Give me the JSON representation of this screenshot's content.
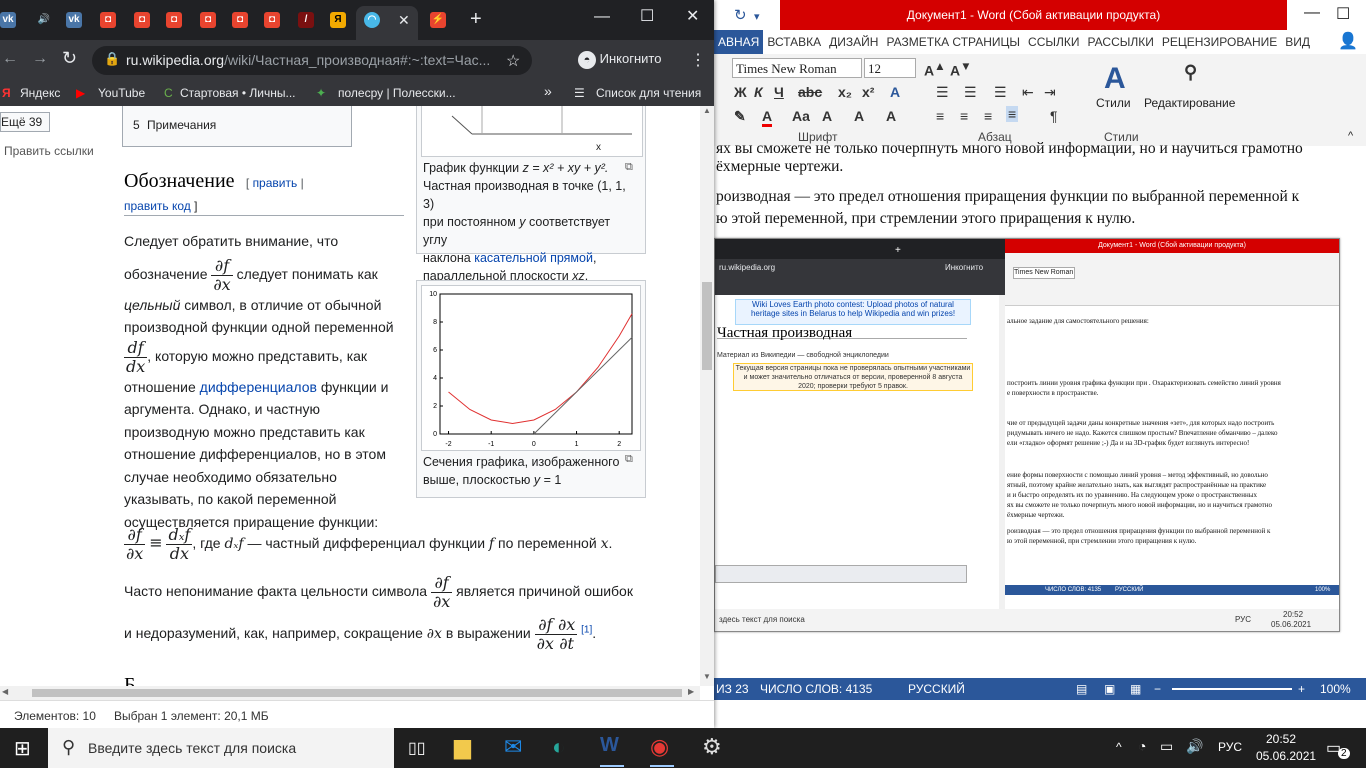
{
  "chrome": {
    "tabs": [
      "Ещё"
    ],
    "new_tab_symbol": "+",
    "address_domain": "ru.wikipedia.org",
    "address_path": "/wiki/Частная_производная#:~:text=Час...",
    "incognito_label": "Инкогнито",
    "bookmarks": [
      "Яндекс",
      "YouTube",
      "Стартовая • Личны...",
      "полесру | Полесски..."
    ],
    "bookmarks_more": "»",
    "reading_list": "Список для чтения",
    "status_elements": "Элементов: 10",
    "status_selected": "Выбран 1 элемент: 20,1 МБ"
  },
  "wiki": {
    "left_more": "Ещё 39",
    "left_edit_links": "Править ссылки",
    "toc_item": "5",
    "toc_item_label": "Примечания",
    "section_heading": "Обозначение",
    "edit_link": "править",
    "edit_code_link": "править код",
    "bracket_open": "[",
    "bracket_sep": "|",
    "bracket_close": "]",
    "p1_a": "Следует обратить внимание, что",
    "p1_b": "обозначение",
    "p1_c": "следует понимать как",
    "p1_d": "цельный",
    "p1_e": "символ, в отличие от обычной",
    "p1_f": "производной функции одной переменной",
    "p1_g": ", которую можно представить, как",
    "p1_h": "отношение",
    "p1_link": "дифференциалов",
    "p1_i": "функции и",
    "p1_j": "аргумента. Однако, и частную",
    "p1_k": "производную можно представить как",
    "p1_l": "отношение дифференциалов, но в этом",
    "p1_m": "случае необходимо обязательно",
    "p1_n": "указывать, по какой переменной",
    "p1_o": "осуществляется приращение функции:",
    "p2_tail": ", где",
    "p2_tail2": "— частный дифференциал функции",
    "p2_tail3": "по переменной",
    "p3_a": "Часто непонимание факта цельности символа",
    "p3_b": "является причиной ошибок",
    "p4_a": "и недоразумений, как, например, сокращение",
    "p4_b": "в выражении",
    "footnote": "[1]",
    "next_heading": "Б",
    "math": {
      "df": "∂f",
      "dx": "∂x",
      "d_f": "df",
      "d_x": "dx",
      "equiv": "≡",
      "dxf": "dₓf",
      "f": "f",
      "x": "x",
      "px": "∂x",
      "dt": "∂t"
    }
  },
  "figure1": {
    "caption_a": "График функции",
    "caption_formula": "z = x² + xy + y².",
    "caption_b": "Частная производная в точке (1, 1, 3)",
    "caption_c": "при постоянном",
    "caption_y": "y",
    "caption_d": "соответствует углу",
    "caption_e": "наклона",
    "caption_link": "касательной прямой",
    "caption_f": ",",
    "caption_g": "параллельной плоскости",
    "caption_xz": "xz",
    "axis_label": "x",
    "caption_dot": "."
  },
  "figure2": {
    "caption_a": "Сечения графика, изображенного",
    "caption_b": "выше, плоскостью",
    "caption_y": "y",
    "caption_c": "= 1"
  },
  "chart_data": {
    "type": "line",
    "xlim": [
      -2.2,
      2.3
    ],
    "ylim": [
      0,
      10
    ],
    "xticks": [
      "-2",
      "-1",
      "0",
      "1",
      "2"
    ],
    "yticks": [
      "10",
      "8",
      "6",
      "4",
      "2",
      "0"
    ],
    "series": [
      {
        "color": "#e03030",
        "x": [
          -2,
          -1.5,
          -1,
          -0.5,
          0,
          0.5,
          1,
          1.5,
          2,
          2.3
        ],
        "y": [
          3,
          1.75,
          1,
          0.75,
          1,
          1.75,
          3,
          4.75,
          7,
          8.59
        ]
      },
      {
        "color": "#666666",
        "x": [
          0,
          1,
          2.3
        ],
        "y": [
          0,
          3,
          6.9
        ]
      }
    ]
  },
  "word": {
    "title": "Документ1 - Word (Сбой активации продукта)",
    "tabs": [
      "АВНАЯ",
      "ВСТАВКА",
      "ДИЗАЙН",
      "РАЗМЕТКА СТРАНИЦЫ",
      "ССЫЛКИ",
      "РАССЫЛКИ",
      "РЕЦЕНЗИРОВАНИЕ",
      "ВИД"
    ],
    "font_name": "Times New Roman",
    "font_size": "12",
    "group_font": "Шрифт",
    "group_para": "Абзац",
    "group_styles": "Стили",
    "styles_label": "Стили",
    "editing_label": "Редактирование",
    "doc_line1": "ях вы сможете не только почерпнуть много новой информации, но и научиться грамотно",
    "doc_line2": "ёхмерные чертежи.",
    "doc_line3": "роизводная — это предел отношения приращения функции по выбранной переменной к",
    "doc_line4": "ю этой переменной, при стремлении этого приращения к нулю.",
    "status_page": "ИЗ 23",
    "status_words": "ЧИСЛО СЛОВ: 4135",
    "status_lang": "РУССКИЙ",
    "zoom": "100%",
    "nested_heading": "Частная производная",
    "nested_source": "Материал из Википедии — свободной энциклопедии",
    "nested_banner_a": "Wiki Loves Earth photo contest: Upload photos of natural",
    "nested_banner_b": "heritage sites in Belarus to help Wikipedia and win prizes!",
    "nested_notice": "Текущая версия страницы пока не проверялась опытными участниками и может значительно отличаться от версии, проверенной 8 августа 2020; проверки требуют 5 правок.",
    "nested_doc_a": "альное задание для самостоятельного решения:",
    "nested_doc_b": "построить линии уровня графика функции при . Охарактеризовать семейство линий уровня",
    "nested_doc_c": "е поверхности в пространстве.",
    "nested_doc_d": "чие от предыдущей задачи даны конкретные значения «зет», для которых надо построить",
    "nested_doc_e": "ридумывать ничего не надо. Кажется слишком простым? Впечатление обманчиво – далеко",
    "nested_doc_f": "ели «гладко» оформят решение ;-) Да и на 3D-график будет взглянуть интересно!",
    "nested_doc_g": "ение формы поверхности с помощью линий уровня – метод эффективный, но довольно",
    "nested_doc_h": "ятный, поэтому крайне желательно знать, как выглядят распространённые на практике",
    "nested_doc_i": "и и быстро определять их по уравнению. На следующем уроке о пространственных",
    "nested_doc_j": "ях вы сможете не только почерпнуть много новой информации, но и научиться грамотно",
    "nested_doc_k": "ёхмерные чертежи.",
    "nested_doc_l": "роизводная — это предел отношения приращения функции по выбранной переменной к",
    "nested_doc_m": "ю этой переменной, при стремлении этого приращения к нулю.",
    "nested_status": "ЧИСЛО СЛОВ: 4135",
    "nested_lang": "РУССКИЙ",
    "nested_zoom": "100%",
    "nested_search": "здесь текст для поиска",
    "nested_time": "20:52",
    "nested_date": "05.06.2021",
    "nested_rus": "РУС"
  },
  "taskbar": {
    "search_placeholder": "Введите здесь текст для поиска",
    "lang": "РУС",
    "time": "20:52",
    "date": "05.06.2021",
    "notif_count": "2"
  }
}
